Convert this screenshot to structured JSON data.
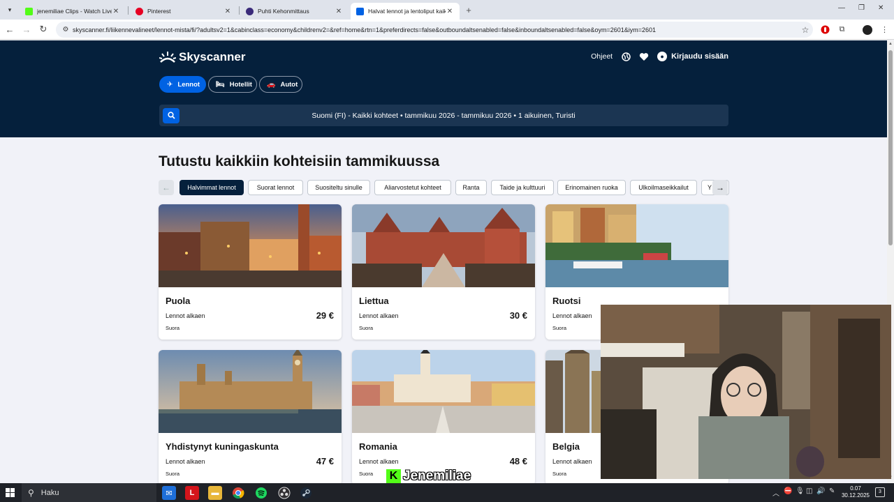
{
  "browser": {
    "tabs": [
      {
        "title": "jenemiliae Clips - Watch Live on",
        "favicon_color": "#53fc18",
        "active": false
      },
      {
        "title": "Pinterest",
        "favicon_color": "#e60023",
        "active": false
      },
      {
        "title": "Puhti Kehonmittaus",
        "favicon_color": "#3a2a7a",
        "active": false
      },
      {
        "title": "Halvat lennot ja lentoliput kaikki",
        "favicon_color": "#0062e3",
        "active": true
      }
    ],
    "new_tab": "+",
    "url": "skyscanner.fi/liikennevalineet/lennot-mista/fi/?adultsv2=1&cabinclass=economy&childrenv2=&ref=home&rtn=1&preferdirects=false&outboundaltsenabled=false&inboundaltsenabled=false&oym=2601&iym=2601",
    "window_controls": [
      "—",
      "❐",
      "✕"
    ]
  },
  "header": {
    "brand": "Skyscanner",
    "help": "Ohjeet",
    "login": "Kirjaudu sisään",
    "nav": [
      {
        "label": "Lennot",
        "icon": "plane-icon",
        "active": true
      },
      {
        "label": "Hotellit",
        "icon": "bed-icon",
        "active": false
      },
      {
        "label": "Autot",
        "icon": "car-icon",
        "active": false
      }
    ],
    "search_summary": "Suomi (FI) - Kaikki kohteet  •  tammikuu 2026 - tammikuu 2026  •  1 aikuinen, Turisti"
  },
  "main": {
    "title": "Tutustu kaikkiin kohteisiin tammikuussa",
    "chips": [
      {
        "label": "Halvimmat lennot",
        "active": true
      },
      {
        "label": "Suorat lennot",
        "active": false
      },
      {
        "label": "Suositeltu sinulle",
        "active": false
      },
      {
        "label": "Aliarvostetut kohteet",
        "active": false
      },
      {
        "label": "Ranta",
        "active": false
      },
      {
        "label": "Taide ja kulttuuri",
        "active": false
      },
      {
        "label": "Erinomainen ruoka",
        "active": false
      },
      {
        "label": "Ulkoilmaseikkailut",
        "active": false
      },
      {
        "label": "Y",
        "active": false
      }
    ],
    "from_label": "Lennot alkaen",
    "cards": [
      {
        "name": "Puola",
        "price": "29 €",
        "direct": "Suora"
      },
      {
        "name": "Liettua",
        "price": "30 €",
        "direct": "Suora"
      },
      {
        "name": "Ruotsi",
        "price": "",
        "direct": "Suora"
      },
      {
        "name": "Yhdistynyt kuningaskunta",
        "price": "47 €",
        "direct": "Suora"
      },
      {
        "name": "Romania",
        "price": "48 €",
        "direct": "Suora"
      },
      {
        "name": "Belgia",
        "price": "",
        "direct": "Suora"
      }
    ]
  },
  "overlay": {
    "watermark": "Jenemiliae"
  },
  "taskbar": {
    "search": "Haku",
    "time": "0.07",
    "date": "30.12.2025",
    "notifications": "3"
  }
}
